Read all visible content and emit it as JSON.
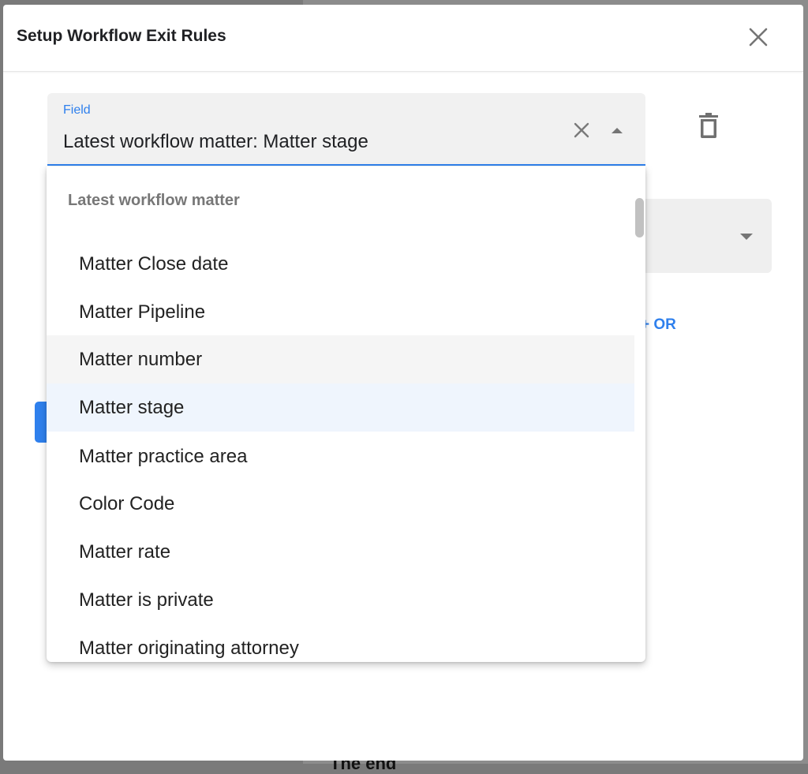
{
  "background": {
    "partial_text": "The end"
  },
  "dialog": {
    "title": "Setup Workflow Exit Rules"
  },
  "field": {
    "label": "Field",
    "value": "Latest workflow matter: Matter stage"
  },
  "or_link": "+ OR",
  "dropdown": {
    "group_label": "Latest workflow matter",
    "options": [
      {
        "label": "Matter Close date",
        "state": "normal"
      },
      {
        "label": "Matter Pipeline",
        "state": "normal"
      },
      {
        "label": "Matter number",
        "state": "hover"
      },
      {
        "label": "Matter stage",
        "state": "selected"
      },
      {
        "label": "Matter practice area",
        "state": "normal"
      },
      {
        "label": "Color Code",
        "state": "normal"
      },
      {
        "label": "Matter rate",
        "state": "normal"
      },
      {
        "label": "Matter is private",
        "state": "normal"
      },
      {
        "label": "Matter originating attorney",
        "state": "normal"
      }
    ]
  },
  "icons": {
    "close": "close-icon",
    "clear": "clear-icon",
    "arrow_up": "arrow-up-icon",
    "trash": "trash-icon",
    "arrow_down": "arrow-down-icon"
  },
  "colors": {
    "accent": "#2f80ed",
    "selected_bg": "#eff5fd",
    "hover_bg": "#f5f5f5"
  }
}
